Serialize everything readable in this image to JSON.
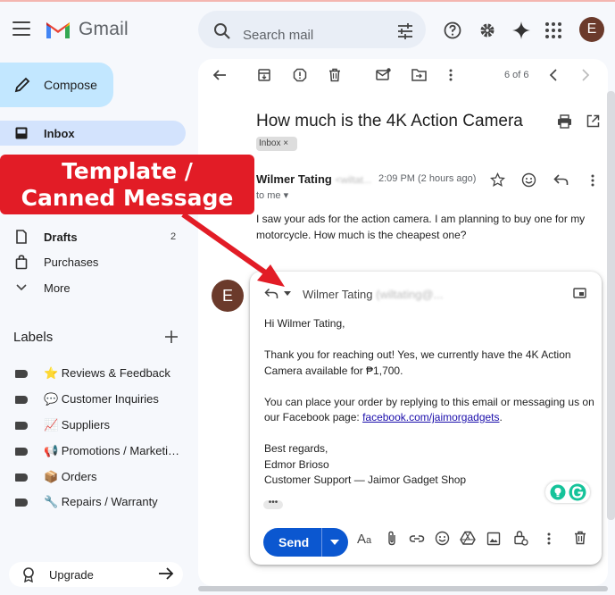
{
  "header": {
    "app_name": "Gmail",
    "search_placeholder": "Search mail",
    "avatar_letter": "E"
  },
  "sidebar": {
    "compose_label": "Compose",
    "items": [
      {
        "label": "Inbox",
        "count": ""
      },
      {
        "label": "Drafts",
        "count": "2"
      },
      {
        "label": "Purchases",
        "count": ""
      },
      {
        "label": "More",
        "count": ""
      }
    ],
    "labels_heading": "Labels",
    "labels": [
      {
        "label": "⭐ Reviews & Feedback"
      },
      {
        "label": "💬 Customer Inquiries"
      },
      {
        "label": "📈 Suppliers"
      },
      {
        "label": "📢 Promotions / Marketi…"
      },
      {
        "label": "📦 Orders"
      },
      {
        "label": "🔧 Repairs / Warranty"
      }
    ],
    "upgrade_label": "Upgrade"
  },
  "toolbar": {
    "pagination": "6 of 6"
  },
  "email": {
    "subject": "How much is the 4K Action Camera",
    "label_chip": "Inbox ×",
    "sender_name": "Wilmer Tating",
    "sender_email_blurred": "<wiltat...",
    "time": "2:09 PM (2 hours ago)",
    "to": "to me ▾",
    "body": "I saw your ads for the action camera. I am planning to buy one for my motorcycle. How much is the cheapest one?"
  },
  "reply": {
    "avatar_letter": "E",
    "to_name": "Wilmer Tating",
    "to_email_blurred": "(wiltating@...",
    "greeting": "Hi Wilmer Tating,",
    "para1": "Thank you for reaching out! Yes, we currently have the 4K Action Camera available for ₱1,700.",
    "para2_prefix": "You can place your order by replying to this email or messaging us on our Facebook page: ",
    "para2_link": "facebook.com/jaimorgadgets",
    "para2_suffix": ".",
    "signoff": "Best regards,",
    "sig_name": "Edmor Brioso",
    "sig_title": "Customer Support — Jaimor Gadget Shop",
    "send_label": "Send",
    "ellipsis": "•••"
  },
  "annotation": {
    "line1": "Template /",
    "line2": "Canned Message",
    "color": "#e21c26"
  }
}
